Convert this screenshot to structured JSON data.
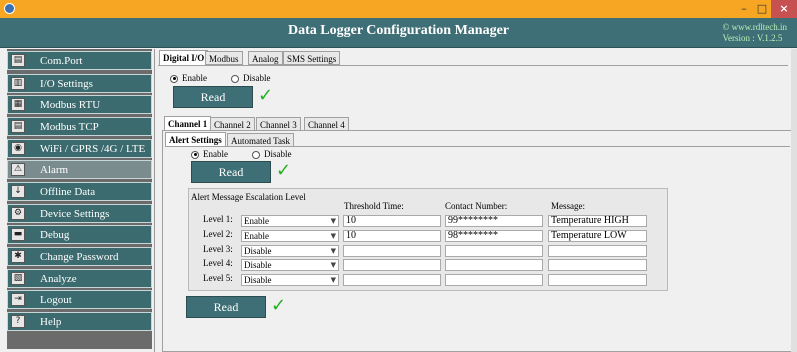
{
  "window": {
    "minimize": "–",
    "maximize": "□",
    "close": "×"
  },
  "header": {
    "title": "Data Logger Configuration Manager",
    "website": "© www.rdltech.in",
    "version": "Version : V.1.2.5"
  },
  "sidebar": {
    "items": [
      {
        "label": "Com.Port",
        "icon": "com-port-icon"
      },
      {
        "label": "I/O Settings",
        "icon": "io-settings-icon"
      },
      {
        "label": "Modbus RTU",
        "icon": "modbus-rtu-icon"
      },
      {
        "label": "Modbus TCP",
        "icon": "modbus-tcp-icon"
      },
      {
        "label": "WiFi / GPRS /4G / LTE",
        "icon": "wifi-icon"
      },
      {
        "label": "Alarm",
        "icon": "alarm-icon"
      },
      {
        "label": "Offline Data",
        "icon": "download-icon"
      },
      {
        "label": "Device Settings",
        "icon": "gear-icon"
      },
      {
        "label": "Debug",
        "icon": "debug-icon"
      },
      {
        "label": "Change Password",
        "icon": "password-icon"
      },
      {
        "label": "Analyze",
        "icon": "analyze-icon"
      },
      {
        "label": "Logout",
        "icon": "logout-icon"
      },
      {
        "label": "Help",
        "icon": "help-icon"
      }
    ],
    "active_index": 5
  },
  "top_tabs": [
    "Digital I/O",
    "Modbus",
    "Analog",
    "SMS Settings"
  ],
  "top_tabs_selected": 0,
  "digital": {
    "enable_label": "Enable",
    "disable_label": "Disable",
    "selected": "Enable",
    "read_label": "Read",
    "status": "✓"
  },
  "channel_tabs": [
    "Channel 1",
    "Channel 2",
    "Channel 3",
    "Channel 4"
  ],
  "channel_selected": 0,
  "alert_tabs": [
    "Alert Settings",
    "Automated Task"
  ],
  "alert_tab_selected": 0,
  "alert": {
    "enable_label": "Enable",
    "disable_label": "Disable",
    "selected": "Enable",
    "read_label": "Read",
    "status": "✓"
  },
  "escalation": {
    "title": "Alert Message Escalation Level",
    "col_threshold": "Threshold Time:",
    "col_contact": "Contact Number:",
    "col_message": "Message:",
    "rows": [
      {
        "label": "Level 1:",
        "mode": "Enable",
        "threshold": "10",
        "contact": "99********",
        "message": "Temperature HIGH"
      },
      {
        "label": "Level 2:",
        "mode": "Enable",
        "threshold": "10",
        "contact": "98********",
        "message": "Temperature LOW"
      },
      {
        "label": "Level 3:",
        "mode": "Disable",
        "threshold": "",
        "contact": "",
        "message": ""
      },
      {
        "label": "Level 4:",
        "mode": "Disable",
        "threshold": "",
        "contact": "",
        "message": ""
      },
      {
        "label": "Level 5:",
        "mode": "Disable",
        "threshold": "",
        "contact": "",
        "message": ""
      }
    ]
  },
  "bottom": {
    "read_label": "Read",
    "status": "✓"
  },
  "colors": {
    "title_bar": "#f6a623",
    "header": "#3f6f76",
    "menu_item": "#3b6b6f",
    "menu_active": "#7b8c8e",
    "success_check": "#22b022"
  }
}
